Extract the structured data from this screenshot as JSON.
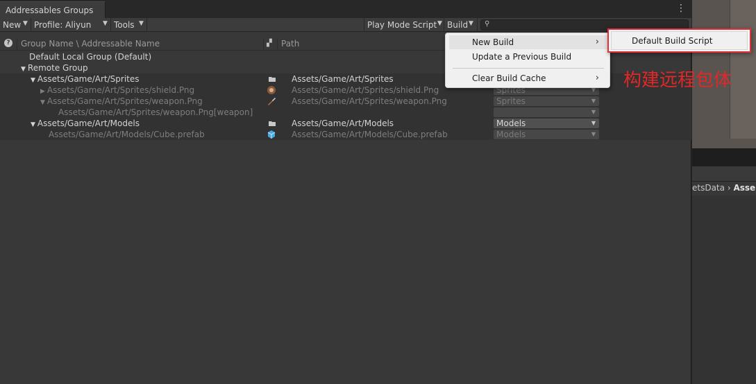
{
  "window": {
    "tab_title": "Addressables Groups"
  },
  "toolbar": {
    "new_label": "New",
    "profile_label": "Profile: Aliyun",
    "tools_label": "Tools",
    "play_mode_label": "Play Mode Script",
    "build_label": "Build",
    "search_placeholder": ""
  },
  "columns": {
    "name": "Group Name \\ Addressable Name",
    "path": "Path"
  },
  "tree": {
    "r0": {
      "name": "Default Local Group (Default)"
    },
    "r1": {
      "name": "Remote Group"
    },
    "r2": {
      "name": "Assets/Game/Art/Sprites",
      "path": "Assets/Game/Art/Sprites"
    },
    "r3": {
      "name": "Assets/Game/Art/Sprites/shield.Png",
      "path": "Assets/Game/Art/Sprites/shield.Png",
      "label": "Sprites"
    },
    "r4": {
      "name": "Assets/Game/Art/Sprites/weapon.Png",
      "path": "Assets/Game/Art/Sprites/weapon.Png",
      "label": "Sprites"
    },
    "r5": {
      "name": "Assets/Game/Art/Sprites/weapon.Png[weapon]",
      "label": ""
    },
    "r6": {
      "name": "Assets/Game/Art/Models",
      "path": "Assets/Game/Art/Models",
      "label": "Models"
    },
    "r7": {
      "name": "Assets/Game/Art/Models/Cube.prefab",
      "path": "Assets/Game/Art/Models/Cube.prefab",
      "label": "Models"
    }
  },
  "build_menu": {
    "new_build": "New Build",
    "update_previous": "Update a Previous Build",
    "clear_cache": "Clear Build Cache"
  },
  "submenu": {
    "default_build_script": "Default Build Script"
  },
  "annotation": "构建远程包体",
  "project_panel": {
    "crumb_a": "etsData",
    "crumb_sep": "›",
    "crumb_b": "Asse"
  },
  "colors": {
    "annotation_red": "#e02828",
    "menu_bg": "#f0f0f0",
    "panel_bg": "#383838"
  }
}
